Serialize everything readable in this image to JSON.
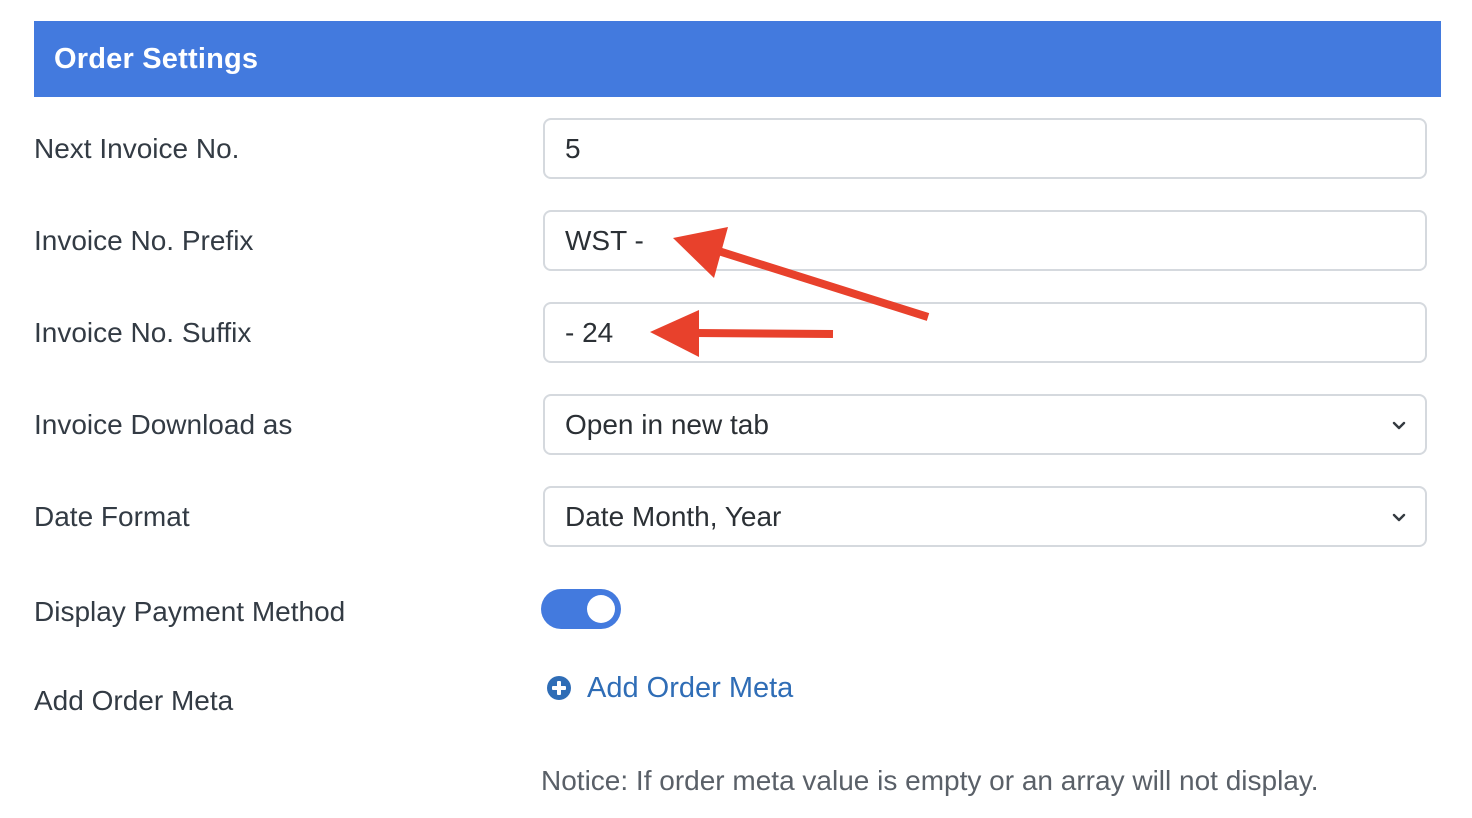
{
  "header": {
    "title": "Order Settings"
  },
  "fields": {
    "next_invoice_no": {
      "label": "Next Invoice No.",
      "value": "5"
    },
    "invoice_prefix": {
      "label": "Invoice No. Prefix",
      "value": "WST -"
    },
    "invoice_suffix": {
      "label": "Invoice No. Suffix",
      "value": "- 24"
    },
    "invoice_download": {
      "label": "Invoice Download as",
      "selected": "Open in new tab"
    },
    "date_format": {
      "label": "Date Format",
      "selected": "Date Month, Year"
    },
    "display_payment_method": {
      "label": "Display Payment Method",
      "enabled": true
    },
    "order_meta": {
      "label": "Add Order Meta",
      "link_label": "Add Order Meta",
      "notice": "Notice: If order meta value is empty or an array will not display."
    }
  },
  "icons": {
    "select_indicator": "chevron-down-icon",
    "add_meta": "plus-circle-icon",
    "annotation": "red-arrow"
  },
  "colors": {
    "header_bg": "#437ade",
    "toggle_on": "#437ade",
    "link": "#2f6db6",
    "annotation_arrow": "#e8412c"
  }
}
